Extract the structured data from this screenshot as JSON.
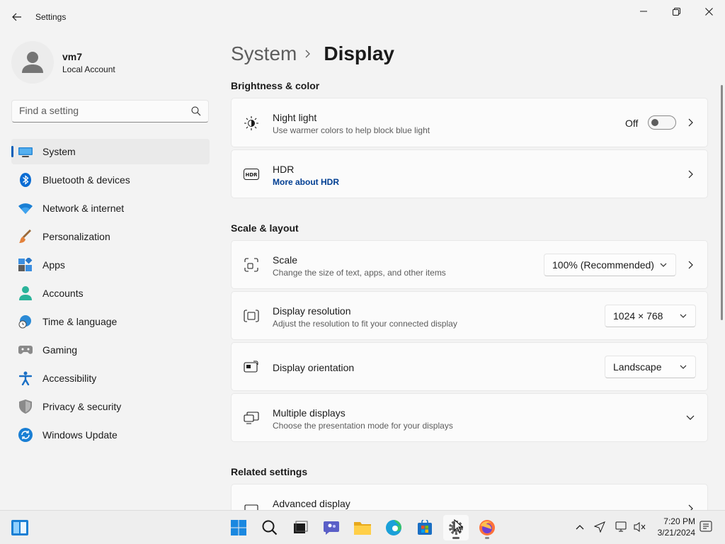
{
  "window": {
    "title": "Settings"
  },
  "profile": {
    "name": "vm7",
    "account_type": "Local Account"
  },
  "search": {
    "placeholder": "Find a setting"
  },
  "nav": [
    {
      "label": "System",
      "icon": "monitor-icon"
    },
    {
      "label": "Bluetooth & devices",
      "icon": "bluetooth-icon"
    },
    {
      "label": "Network & internet",
      "icon": "wifi-icon"
    },
    {
      "label": "Personalization",
      "icon": "paintbrush-icon"
    },
    {
      "label": "Apps",
      "icon": "apps-icon"
    },
    {
      "label": "Accounts",
      "icon": "person-icon"
    },
    {
      "label": "Time & language",
      "icon": "globe-clock-icon"
    },
    {
      "label": "Gaming",
      "icon": "gamepad-icon"
    },
    {
      "label": "Accessibility",
      "icon": "accessibility-icon"
    },
    {
      "label": "Privacy & security",
      "icon": "shield-icon"
    },
    {
      "label": "Windows Update",
      "icon": "update-icon"
    }
  ],
  "nav_active": "System",
  "breadcrumb": {
    "parent": "System",
    "current": "Display"
  },
  "sections": {
    "brightness": "Brightness & color",
    "scale_layout": "Scale & layout",
    "related": "Related settings"
  },
  "cards": {
    "night_light": {
      "title": "Night light",
      "desc": "Use warmer colors to help block blue light",
      "state": "Off"
    },
    "hdr": {
      "title": "HDR",
      "link": "More about HDR"
    },
    "scale": {
      "title": "Scale",
      "desc": "Change the size of text, apps, and other items",
      "value": "100% (Recommended)"
    },
    "resolution": {
      "title": "Display resolution",
      "desc": "Adjust the resolution to fit your connected display",
      "value": "1024 × 768"
    },
    "orientation": {
      "title": "Display orientation",
      "value": "Landscape"
    },
    "multiple": {
      "title": "Multiple displays",
      "desc": "Choose the presentation mode for your displays"
    },
    "advanced": {
      "title": "Advanced display"
    }
  },
  "taskbar": {
    "apps": [
      "start-icon",
      "search-icon",
      "task-view-icon",
      "chat-icon",
      "file-explorer-icon",
      "edge-icon",
      "store-icon",
      "settings-icon",
      "firefox-icon"
    ],
    "time": "7:20 PM",
    "date": "3/21/2024"
  },
  "colors": {
    "accent": "#005fb8",
    "background": "#f3f3f3",
    "card": "#fbfbfb"
  }
}
